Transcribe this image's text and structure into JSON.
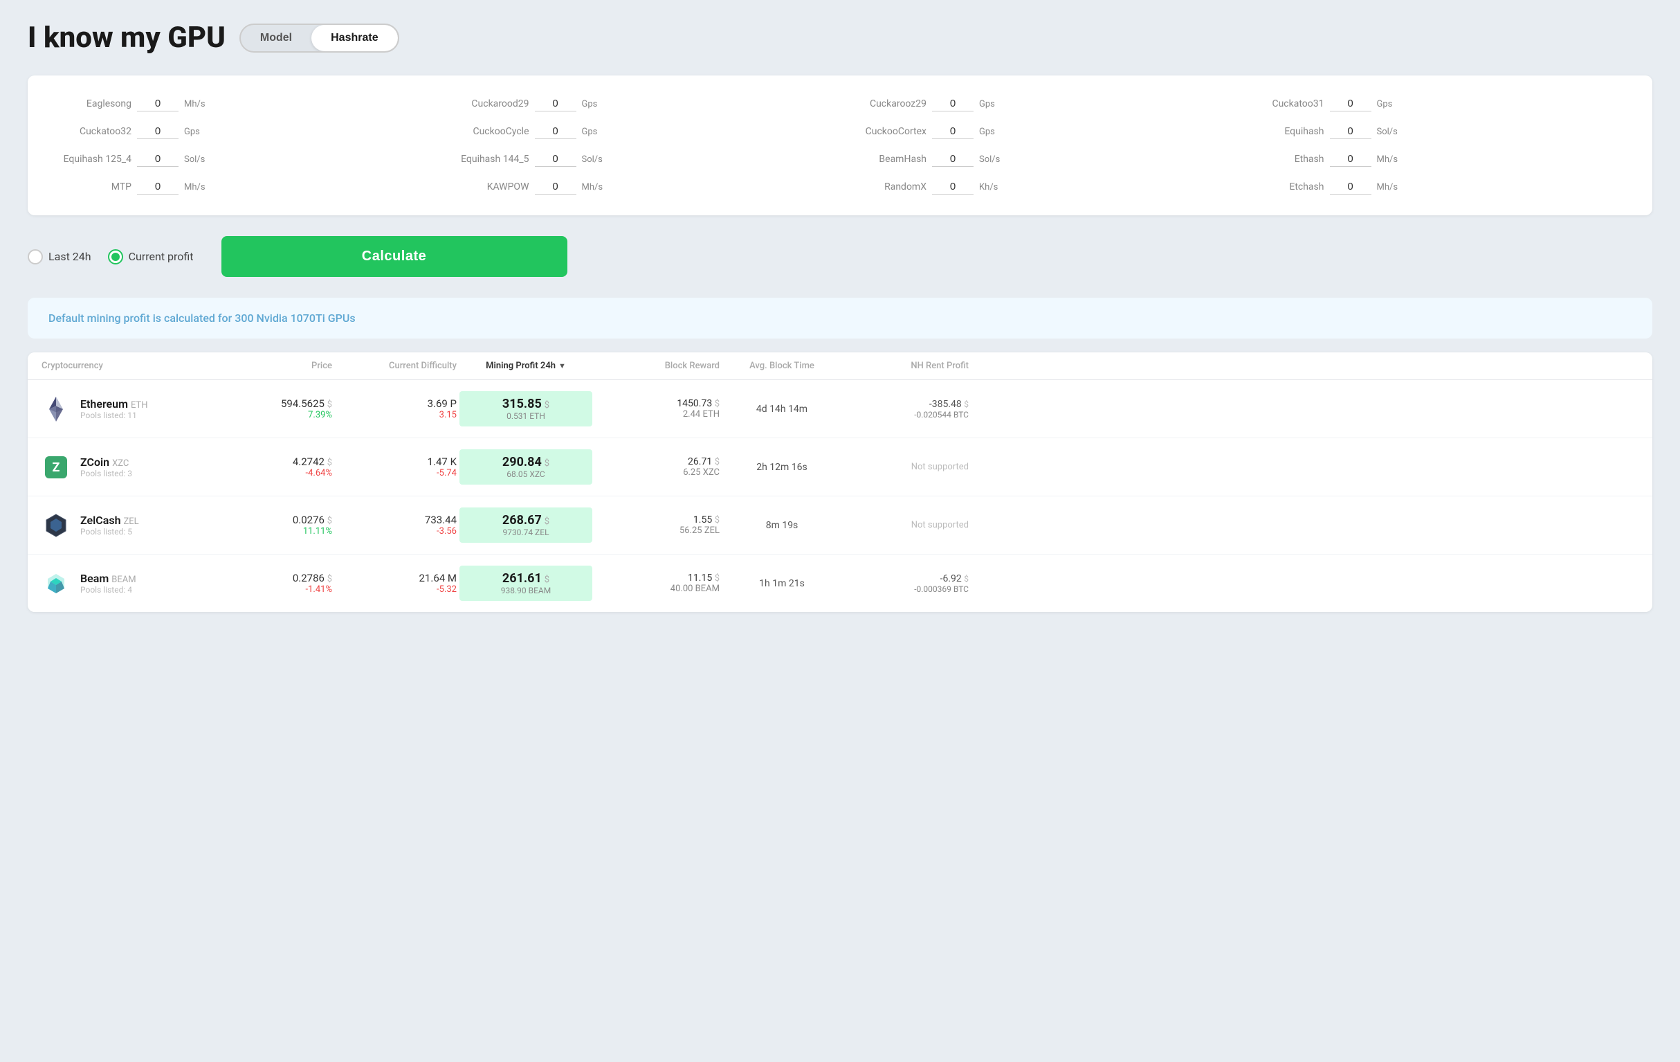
{
  "header": {
    "title": "I know my GPU",
    "mode_model": "Model",
    "mode_hashrate": "Hashrate",
    "active_mode": "Hashrate"
  },
  "hashrate_fields": [
    {
      "label": "Eaglesong",
      "value": "0",
      "unit": "Mh/s"
    },
    {
      "label": "Cuckarood29",
      "value": "0",
      "unit": "Gps"
    },
    {
      "label": "Cuckarooz29",
      "value": "0",
      "unit": "Gps"
    },
    {
      "label": "Cuckatoo31",
      "value": "0",
      "unit": "Gps"
    },
    {
      "label": "Cuckatoo32",
      "value": "0",
      "unit": "Gps"
    },
    {
      "label": "CuckooCycle",
      "value": "0",
      "unit": "Gps"
    },
    {
      "label": "CuckooCortex",
      "value": "0",
      "unit": "Gps"
    },
    {
      "label": "Equihash",
      "value": "0",
      "unit": "Sol/s"
    },
    {
      "label": "Equihash 125_4",
      "value": "0",
      "unit": "Sol/s"
    },
    {
      "label": "Equihash 144_5",
      "value": "0",
      "unit": "Sol/s"
    },
    {
      "label": "BeamHash",
      "value": "0",
      "unit": "Sol/s"
    },
    {
      "label": "Ethash",
      "value": "0",
      "unit": "Mh/s"
    },
    {
      "label": "MTP",
      "value": "0",
      "unit": "Mh/s"
    },
    {
      "label": "KAWPOW",
      "value": "0",
      "unit": "Mh/s"
    },
    {
      "label": "RandomX",
      "value": "0",
      "unit": "Kh/s"
    },
    {
      "label": "Etchash",
      "value": "0",
      "unit": "Mh/s"
    }
  ],
  "controls": {
    "last24h_label": "Last 24h",
    "current_profit_label": "Current profit",
    "calculate_label": "Calculate",
    "active_radio": "current_profit"
  },
  "info_banner": {
    "text": "Default mining profit is calculated for 300 Nvidia 1070Ti GPUs"
  },
  "table": {
    "headers": [
      {
        "label": "Cryptocurrency",
        "key": "cryptocurrency"
      },
      {
        "label": "Price",
        "key": "price"
      },
      {
        "label": "Current Difficulty",
        "key": "difficulty"
      },
      {
        "label": "Mining Profit 24h",
        "key": "profit",
        "sorted": true
      },
      {
        "label": "Block Reward",
        "key": "block_reward"
      },
      {
        "label": "Avg. Block Time",
        "key": "block_time"
      },
      {
        "label": "NH Rent Profit",
        "key": "nh_rent"
      }
    ],
    "rows": [
      {
        "coin": "Ethereum",
        "ticker": "ETH",
        "pools": 11,
        "icon_type": "eth",
        "price_value": "594.5625",
        "price_change": "7.39%",
        "price_change_positive": true,
        "difficulty": "3.69 P",
        "difficulty_change": "3.15",
        "difficulty_change_positive": false,
        "profit_main": "315.85",
        "profit_coin": "0.531 ETH",
        "block_reward": "1450.73",
        "block_reward_coin": "2.44 ETH",
        "block_time": "4d 14h 14m",
        "nh_rent": "-385.48",
        "nh_rent_btc": "-0.020544 BTC",
        "nh_supported": true
      },
      {
        "coin": "ZCoin",
        "ticker": "XZC",
        "pools": 3,
        "icon_type": "xcz",
        "price_value": "4.2742",
        "price_change": "-4.64%",
        "price_change_positive": false,
        "difficulty": "1.47 K",
        "difficulty_change": "-5.74",
        "difficulty_change_positive": false,
        "profit_main": "290.84",
        "profit_coin": "68.05 XZC",
        "block_reward": "26.71",
        "block_reward_coin": "6.25 XZC",
        "block_time": "2h 12m 16s",
        "nh_rent": null,
        "nh_rent_btc": null,
        "nh_supported": false
      },
      {
        "coin": "ZelCash",
        "ticker": "ZEL",
        "pools": 5,
        "icon_type": "zel",
        "price_value": "0.0276",
        "price_change": "11.11%",
        "price_change_positive": true,
        "difficulty": "733.44",
        "difficulty_change": "-3.56",
        "difficulty_change_positive": false,
        "profit_main": "268.67",
        "profit_coin": "9730.74 ZEL",
        "block_reward": "1.55",
        "block_reward_coin": "56.25 ZEL",
        "block_time": "8m 19s",
        "nh_rent": null,
        "nh_rent_btc": null,
        "nh_supported": false
      },
      {
        "coin": "Beam",
        "ticker": "BEAM",
        "pools": 4,
        "icon_type": "beam",
        "price_value": "0.2786",
        "price_change": "-1.41%",
        "price_change_positive": false,
        "difficulty": "21.64 M",
        "difficulty_change": "-5.32",
        "difficulty_change_positive": false,
        "profit_main": "261.61",
        "profit_coin": "938.90 BEAM",
        "block_reward": "11.15",
        "block_reward_coin": "40.00 BEAM",
        "block_time": "1h 1m 21s",
        "nh_rent": "-6.92",
        "nh_rent_btc": "-0.000369 BTC",
        "nh_supported": true
      }
    ]
  }
}
